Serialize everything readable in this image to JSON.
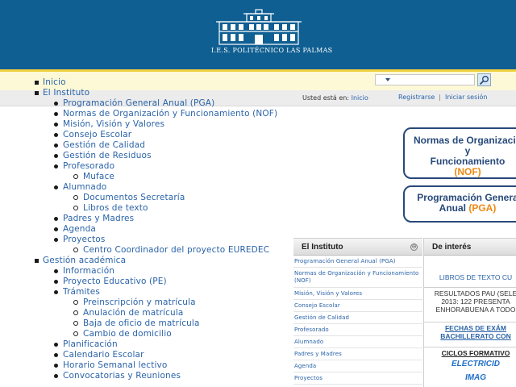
{
  "header": {
    "logo_text": "I.E.S. POLITÉCNICO LAS PALMAS"
  },
  "search": {
    "selected": ""
  },
  "breadcrumb": {
    "label": "Usted está en:",
    "current": "Inicio"
  },
  "user_links": {
    "register": "Registrarse",
    "separator": "|",
    "login": "Iniciar sesión"
  },
  "menu": {
    "items": [
      {
        "label": "Inicio",
        "level": 0
      },
      {
        "label": "El Instituto",
        "level": 0
      },
      {
        "label": "Programación General Anual (PGA)",
        "level": 1
      },
      {
        "label": "Normas de Organización y Funcionamiento (NOF)",
        "level": 1
      },
      {
        "label": "Misión, Visión y Valores",
        "level": 1
      },
      {
        "label": "Consejo Escolar",
        "level": 1
      },
      {
        "label": "Gestión de Calidad",
        "level": 1
      },
      {
        "label": "Gestión de Residuos",
        "level": 1
      },
      {
        "label": "Profesorado",
        "level": 1
      },
      {
        "label": "Muface",
        "level": 2
      },
      {
        "label": "Alumnado",
        "level": 1
      },
      {
        "label": "Documentos Secretaría",
        "level": 2
      },
      {
        "label": "Libros de texto",
        "level": 2
      },
      {
        "label": "Padres y Madres",
        "level": 1
      },
      {
        "label": "Agenda",
        "level": 1
      },
      {
        "label": "Proyectos",
        "level": 1
      },
      {
        "label": "Centro Coordinador del proyecto EUREDEC",
        "level": 2
      },
      {
        "label": "Gestión académica",
        "level": 0
      },
      {
        "label": "Información",
        "level": 1
      },
      {
        "label": "Proyecto Educativo (PE)",
        "level": 1
      },
      {
        "label": "Trámites",
        "level": 1
      },
      {
        "label": "Preinscripción y matrícula",
        "level": 2
      },
      {
        "label": "Anulación de matrícula",
        "level": 2
      },
      {
        "label": "Baja de oficio de matrícula",
        "level": 2
      },
      {
        "label": "Cambio de domicilio",
        "level": 2
      },
      {
        "label": "Planificación",
        "level": 1
      },
      {
        "label": "Calendario Escolar",
        "level": 1
      },
      {
        "label": "Horario Semanal lectivo",
        "level": 1
      },
      {
        "label": "Convocatorias y Reuniones",
        "level": 1
      }
    ]
  },
  "banners": {
    "nof": {
      "line1": "Normas de Organizació",
      "line2": "y",
      "line3": "Funcionamiento",
      "tag": "(NOF)"
    },
    "pga": {
      "line1": "Programación Genera",
      "line2": "Anual",
      "tag": "(PGA)"
    }
  },
  "instituto_panel": {
    "title": "El Instituto",
    "toggle": "⊖",
    "items": [
      "Programación General Anual (PGA)",
      "Normas de Organización y Funcionamiento (NOF)",
      "Misión, Visión y Valores",
      "Consejo Escolar",
      "Gestión de Calidad",
      "Profesorado",
      "Alumnado",
      "Padres y Madres",
      "Agenda",
      "Proyectos"
    ]
  },
  "interes_panel": {
    "title": "De interés",
    "libros": "LIBROS DE TEXTO CU",
    "pau": [
      "RESULTADOS PAU (SELE",
      "2013: 122 PRESENTA",
      "ENHORABUENA A TODO"
    ],
    "fechas": [
      "FECHAS DE EXÁM",
      "BACHILLERATO CON"
    ],
    "ciclos": "CICLOS FORMATIVO",
    "electricidad": "ELECTRICID",
    "imagen": "IMAG"
  }
}
